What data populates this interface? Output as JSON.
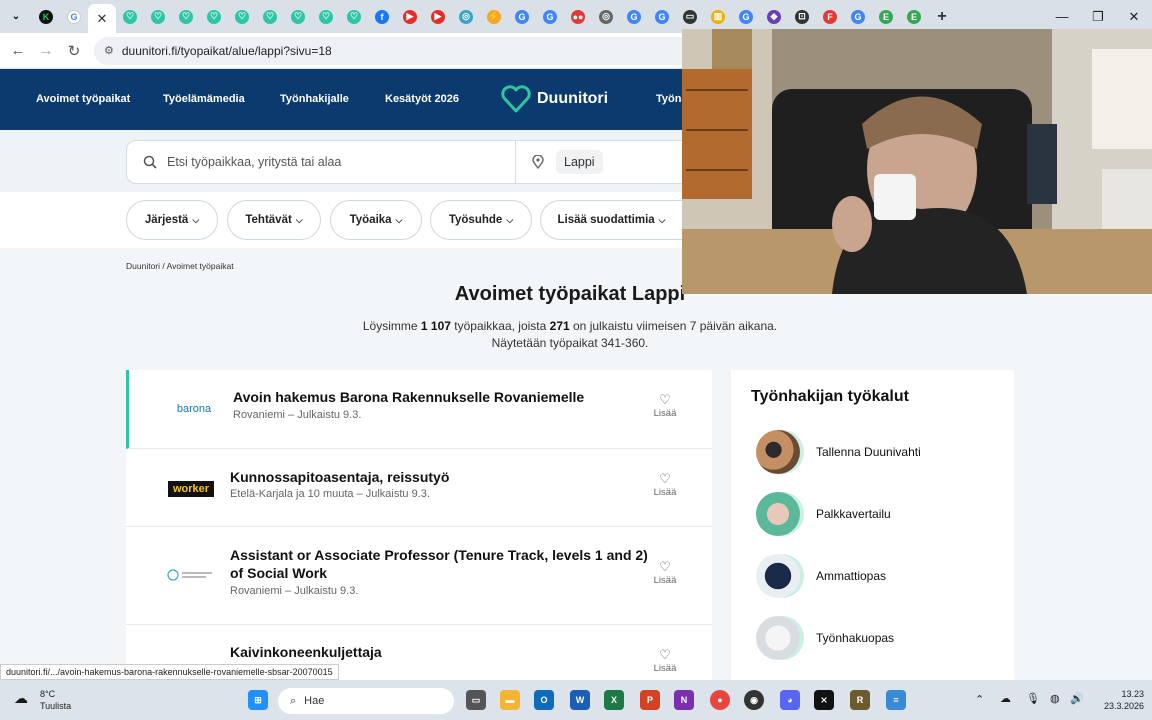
{
  "browser": {
    "url": "duunitori.fi/tyopaikat/alue/lappi?sivu=18",
    "tabs": [
      "K",
      "G",
      "✕",
      "♡",
      "♡",
      "♡",
      "♡",
      "♡",
      "♡",
      "♡",
      "♡",
      "♡",
      "f",
      "▶",
      "▶",
      "◎",
      "⚡",
      "G",
      "G",
      "●●",
      "◎",
      "G",
      "G",
      "▭",
      "▥",
      "G",
      "◆",
      "⊡",
      "F",
      "G",
      "E",
      "E"
    ]
  },
  "site": {
    "nav": [
      "Avoimet työpaikat",
      "Työelämämedia",
      "Työnhakijalle",
      "Kesätyöt 2026",
      "Työna"
    ],
    "logo": "Duunitori",
    "search_placeholder": "Etsi työpaikkaa, yritystä tai alaa",
    "location": "Lappi",
    "filters": [
      "Järjestä",
      "Tehtävät",
      "Työaika",
      "Työsuhde",
      "Lisää suodattimia"
    ]
  },
  "breadcrumb": "Duunitori / Avoimet työpaikat",
  "heading": "Avoimet työpaikat Lappi",
  "summary": {
    "line1_pre": "Löysimme ",
    "total": "1 107",
    "line1_mid": " työpaikkaa, joista ",
    "recent": "271",
    "line1_post": " on julkaistu viimeisen 7 päivän aikana.",
    "line2": "Näytetään työpaikat 341-360."
  },
  "jobs": [
    {
      "company_logo": "barona",
      "title": "Avoin hakemus Barona Rakennukselle Rovaniemelle",
      "meta": "Rovaniemi – Julkaistu 9.3.",
      "fav": "Lisää"
    },
    {
      "company_logo": "worker",
      "title": "Kunnossapitoasentaja, reissutyö",
      "meta": "Etelä-Karjala ja 10 muuta – Julkaistu 9.3.",
      "fav": "Lisää"
    },
    {
      "company_logo": "",
      "title": "Assistant or Associate Professor (Tenure Track, levels 1 and 2) of Social Work",
      "meta": "Rovaniemi – Julkaistu 9.3.",
      "fav": "Lisää"
    },
    {
      "company_logo": "",
      "title": "Kaivinkoneenkuljettaja",
      "meta": "",
      "fav": "Lisää"
    }
  ],
  "tools": {
    "title": "Työnhakijan työkalut",
    "items": [
      "Tallenna Duunivahti",
      "Palkkavertailu",
      "Ammattiopas",
      "Työnhakuopas"
    ]
  },
  "status_link": "duunitori.fi/.../avoin-hakemus-barona-rakennukselle-rovaniemelle-sbsar-20070015",
  "taskbar": {
    "temp": "8°C",
    "weather": "Tuulista",
    "search": "Hae",
    "time": "13.23",
    "date": "23.3.2026"
  },
  "colors": {
    "header": "#0b3a6e",
    "accent": "#2ec5a5",
    "page_bg": "#f3f6f8"
  }
}
